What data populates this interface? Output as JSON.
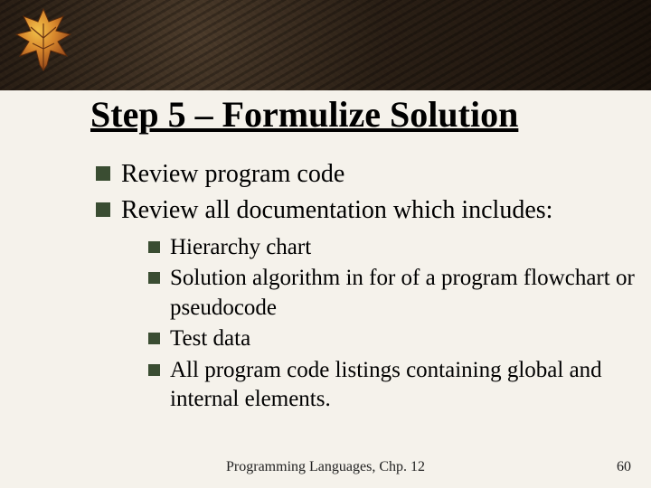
{
  "title": "Step 5 – Formulize Solution",
  "bullets": {
    "b1": "Review program code",
    "b2": "Review all documentation which includes:",
    "sub": {
      "s1": "Hierarchy chart",
      "s2": "Solution algorithm in for of a program flowchart or pseudocode",
      "s3": "Test data",
      "s4": "All program code listings containing global and internal elements."
    }
  },
  "footer": {
    "center": "Programming Languages, Chp. 12",
    "page": "60"
  }
}
